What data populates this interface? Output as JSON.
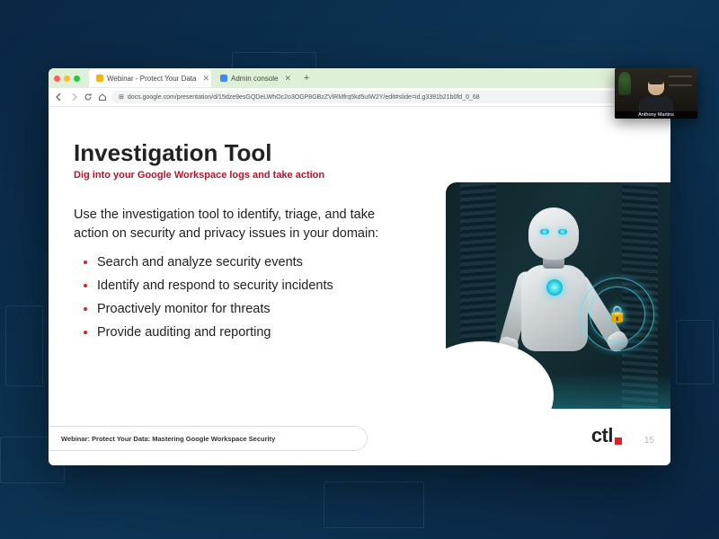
{
  "browser": {
    "tabs": [
      {
        "label": "Webinar - Protect Your Data",
        "favColor": "#f4b400"
      },
      {
        "label": "Admin console",
        "favColor": "#4285f4"
      }
    ],
    "url": "docs.google.com/presentation/d/15dze9esGQDeLWhOc2o3OGP8GBzZViRMfrq5kd5uIW2Y/edit#slide=id.g3391b21b0fd_0_68"
  },
  "slide": {
    "title": "Investigation Tool",
    "subtitle": "Dig into your Google Workspace logs and take action",
    "intro": "Use the investigation tool to identify, triage, and take action on security and privacy issues in your domain:",
    "bullets": [
      "Search and analyze security events",
      "Identify and respond to security incidents",
      "Proactively monitor for threats",
      "Provide auditing and reporting"
    ],
    "footer": "Webinar: Protect Your Data: Mastering Google Workspace Security",
    "logo": "ctl",
    "page": "15"
  },
  "webcam": {
    "name": "Anthony Martins"
  }
}
